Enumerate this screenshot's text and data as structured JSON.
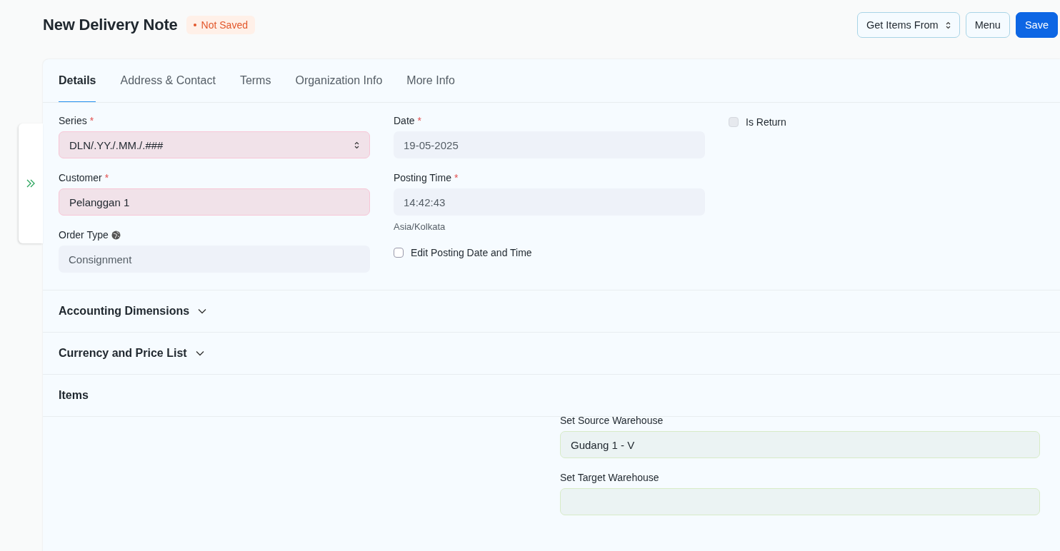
{
  "page": {
    "title": "New Delivery Note",
    "indicator": "Not Saved"
  },
  "actions": [
    {
      "label": "Get Items From",
      "kind": "dropdown"
    },
    {
      "label": "Menu",
      "kind": "default"
    },
    {
      "label": "Save",
      "kind": "primary"
    }
  ],
  "tabs": [
    {
      "label": "Details",
      "selected": true
    },
    {
      "label": "Address & Contact",
      "selected": false
    },
    {
      "label": "Terms",
      "selected": false
    },
    {
      "label": "Organization Info",
      "selected": false
    },
    {
      "label": "More Info",
      "selected": false
    }
  ],
  "columns": [
    [
      {
        "kind": "select",
        "label": "Series",
        "required_mark": "*",
        "invalid": true,
        "value": "DLN/.YY./.MM./.###"
      },
      {
        "kind": "input",
        "label": "Customer",
        "required_mark": "*",
        "invalid": true,
        "value": "Pelanggan 1"
      },
      {
        "kind": "input",
        "label": "Order Type",
        "invalid": false,
        "globe": true,
        "value": "Consignment"
      }
    ],
    [
      {
        "kind": "input",
        "label": "Date",
        "required_mark": "*",
        "invalid": false,
        "value": "19-05-2025"
      },
      {
        "kind": "input",
        "label": "Posting Time",
        "required_mark": "*",
        "invalid": false,
        "value": "14:42:43",
        "description": "Asia/Kolkata"
      },
      {
        "kind": "checkbox",
        "label": "Edit Posting Date and Time",
        "checked": false,
        "disabled": false
      }
    ],
    [
      {
        "kind": "checkbox",
        "label": "Is Return",
        "checked": false,
        "disabled": true
      }
    ]
  ],
  "sections": [
    {
      "title": "Accounting Dimensions",
      "kind": "collapsed"
    },
    {
      "title": "Currency and Price List",
      "kind": "collapsed"
    },
    {
      "title": "Items",
      "kind": "plain"
    }
  ],
  "warehouses": [
    {
      "label": "Set Source Warehouse",
      "value": "Gudang 1 - V"
    },
    {
      "label": "Set Target Warehouse"
    }
  ]
}
